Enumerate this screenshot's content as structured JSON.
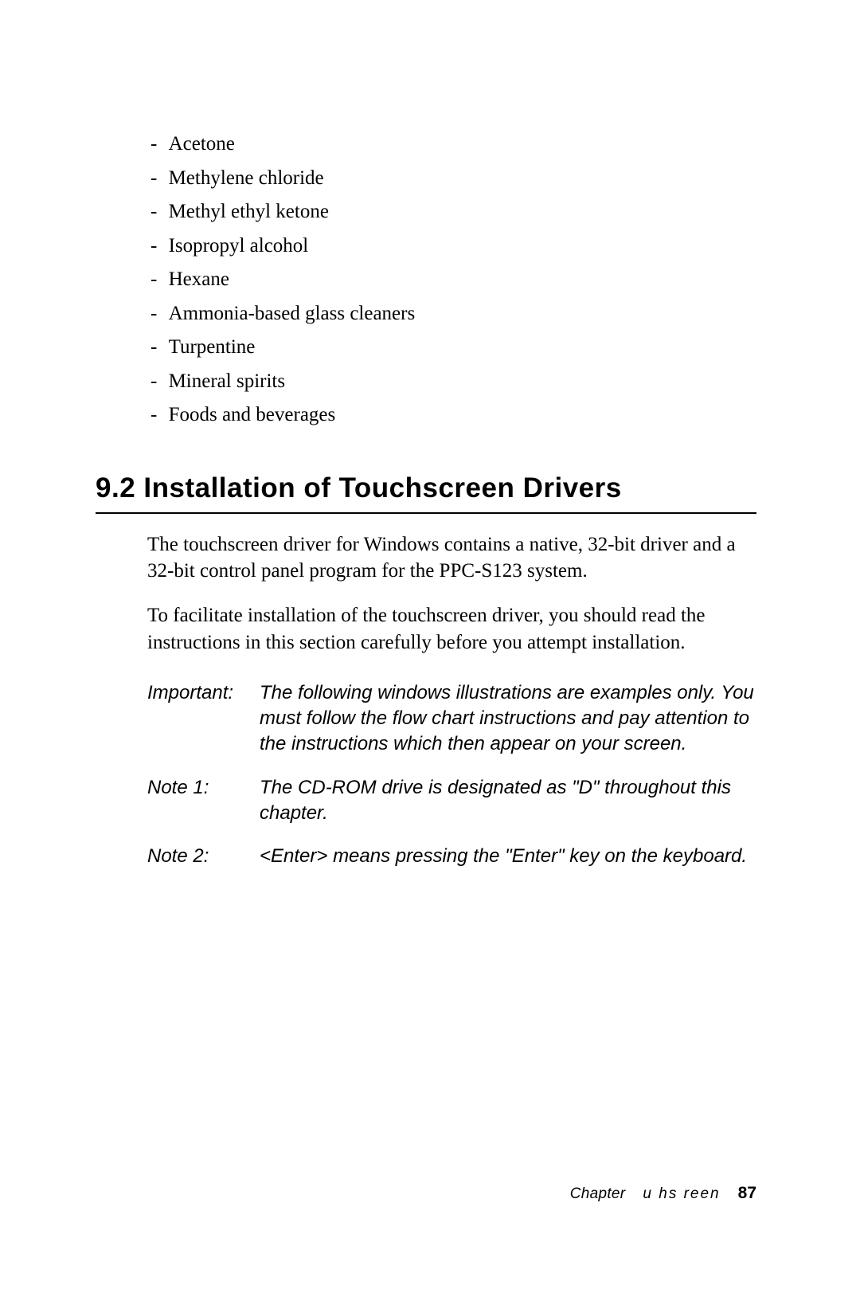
{
  "bullets": {
    "b0": "Acetone",
    "b1": "Methylene chloride",
    "b2": "Methyl ethyl ketone",
    "b3": "Isopropyl alcohol",
    "b4": "Hexane",
    "b5": "Ammonia-based glass cleaners",
    "b6": "Turpentine",
    "b7": "Mineral spirits",
    "b8": "Foods and beverages"
  },
  "section": {
    "number": "9.2",
    "title": "Installation of Touchscreen Drivers",
    "heading_full": "9.2   Installation of Touchscreen Drivers"
  },
  "paragraphs": {
    "p1": "The touchscreen driver for Windows contains a native, 32-bit driver and a 32-bit control panel program for the PPC-S123 system.",
    "p2": "To facilitate installation of the touchscreen driver, you should read the instructions in this section carefully before you attempt installation."
  },
  "notes": {
    "important_label": "Important:",
    "important_text": "The following windows illustrations are examples only. You must follow the flow chart instructions and pay attention to the instructions which then appear on your screen.",
    "note1_label": "Note 1:",
    "note1_text": "The CD-ROM drive is designated as \"D\" throughout this chapter.",
    "note2_label": "Note 2:",
    "note2_text": "<Enter> means pressing the \"Enter\" key on the keyboard."
  },
  "footer": {
    "chapter_word": "Chapter",
    "topic": "u hs reen",
    "page_number": "87"
  }
}
